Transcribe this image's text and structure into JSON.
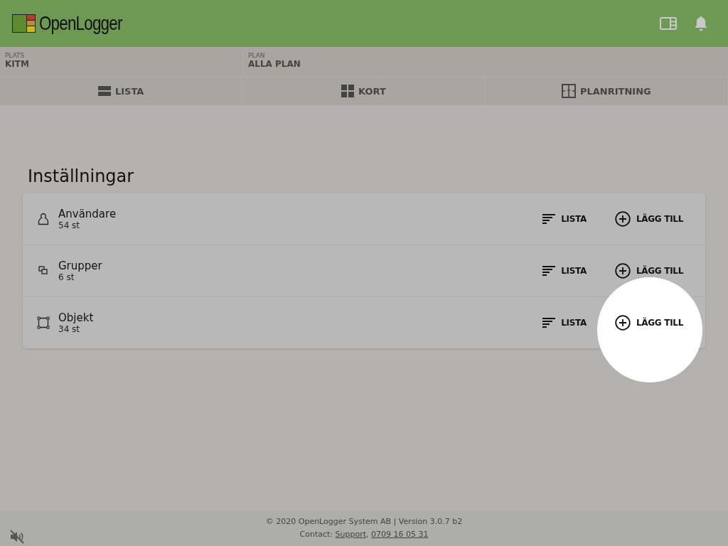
{
  "header": {
    "logo": "OpenLogger"
  },
  "filters": [
    {
      "label": "PLATS",
      "value": "KITM"
    },
    {
      "label": "PLAN",
      "value": "ALLA PLAN"
    }
  ],
  "tabs": [
    {
      "kind": "list",
      "label": "LISTA",
      "selected": false
    },
    {
      "kind": "cards",
      "label": "KORT",
      "selected": false
    },
    {
      "kind": "floorplan",
      "label": "PLANRITNING",
      "selected": false
    }
  ],
  "page_title": "Inställningar",
  "rows": [
    {
      "kind": "user",
      "name": "Användare",
      "count": "54 st",
      "list_label": "LISTA",
      "add_label": "LÄGG TILL",
      "highlighted": false
    },
    {
      "kind": "groups",
      "name": "Grupper",
      "count": "6 st",
      "list_label": "LISTA",
      "add_label": "LÄGG TILL",
      "highlighted": false
    },
    {
      "kind": "object",
      "name": "Objekt",
      "count": "34 st",
      "list_label": "LISTA",
      "add_label": "LÄGG TILL",
      "highlighted": true
    }
  ],
  "footer": {
    "copyright": "© 2020 OpenLogger System AB | Version 3.0.7 b2",
    "contact_label": "Contact:",
    "support_link": "Support",
    "separator": ",",
    "phone_link": "0709 16 05 31"
  }
}
